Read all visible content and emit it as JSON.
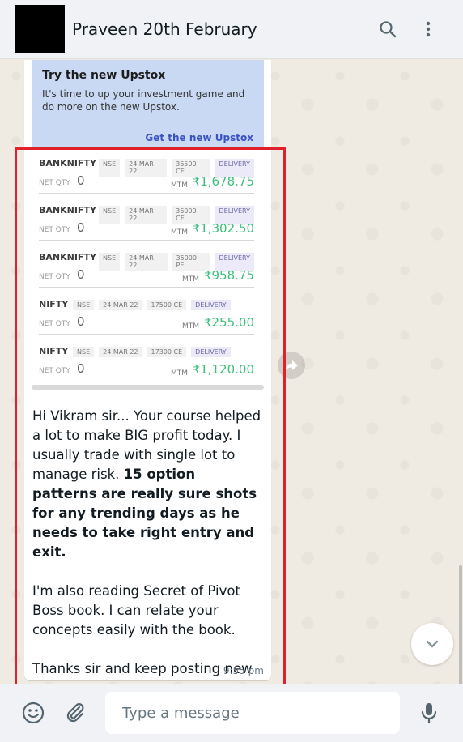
{
  "header": {
    "title": "Praveen 20th February"
  },
  "ad": {
    "title": "Try the new Upstox",
    "text": "It's time to up your investment game and do more on the new Upstox.",
    "link": "Get the new Upstox"
  },
  "positions": [
    {
      "symbol": "BANKNIFTY",
      "exchange": "NSE",
      "expiry": "24 MAR 22",
      "strike": "36500 CE",
      "product": "DELIVERY",
      "netqty_label": "NET QTY",
      "netqty": "0",
      "mtm_label": "MTM",
      "mtm": "₹1,678.75"
    },
    {
      "symbol": "BANKNIFTY",
      "exchange": "NSE",
      "expiry": "24 MAR 22",
      "strike": "36000 CE",
      "product": "DELIVERY",
      "netqty_label": "NET QTY",
      "netqty": "0",
      "mtm_label": "MTM",
      "mtm": "₹1,302.50"
    },
    {
      "symbol": "BANKNIFTY",
      "exchange": "NSE",
      "expiry": "24 MAR 22",
      "strike": "35000 PE",
      "product": "DELIVERY",
      "netqty_label": "NET QTY",
      "netqty": "0",
      "mtm_label": "MTM",
      "mtm": "₹958.75"
    },
    {
      "symbol": "NIFTY",
      "exchange": "NSE",
      "expiry": "24 MAR 22",
      "strike": "17500 CE",
      "product": "DELIVERY",
      "netqty_label": "NET QTY",
      "netqty": "0",
      "mtm_label": "MTM",
      "mtm": "₹255.00"
    },
    {
      "symbol": "NIFTY",
      "exchange": "NSE",
      "expiry": "24 MAR 22",
      "strike": "17300 CE",
      "product": "DELIVERY",
      "netqty_label": "NET QTY",
      "netqty": "0",
      "mtm_label": "MTM",
      "mtm": "₹1,120.00"
    }
  ],
  "message": {
    "p1_normal": "Hi Vikram sir... Your course helped a lot to make BIG profit today. I usually trade with single lot to manage risk. ",
    "p1_bold": "15 option patterns are really sure shots for any trending days as he needs to take right entry and exit.",
    "p2": "I'm also reading Secret of Pivot Boss book. I can relate your concepts easily with the book.",
    "p3": "Thanks sir and keep posting new educational videos...",
    "p3_emoji": "🙏",
    "time": "9:55 pm"
  },
  "composer": {
    "placeholder": "Type a message"
  },
  "colors": {
    "highlight": "#e0202a",
    "mtm_green": "#3bbf7a",
    "ad_background": "#c9d8f3",
    "link_blue": "#3a52c2"
  },
  "icons": [
    "search-icon",
    "more-vert-icon",
    "forward-icon",
    "chevron-down-icon",
    "emoji-icon",
    "attach-icon",
    "mic-icon"
  ]
}
